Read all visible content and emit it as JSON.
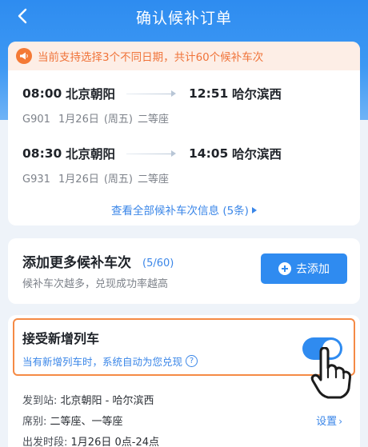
{
  "nav": {
    "title": "确认候补订单"
  },
  "notice": {
    "text": "当前支持选择3个不同日期，共计60个候补车次"
  },
  "trains": [
    {
      "depart_time": "08:00",
      "depart_station": "北京朝阳",
      "arrive_time": "12:51",
      "arrive_station": "哈尔滨西",
      "train_no": "G901",
      "date": "1月26日",
      "weekday": "(周五)",
      "seat": "二等座"
    },
    {
      "depart_time": "08:30",
      "depart_station": "北京朝阳",
      "arrive_time": "14:05",
      "arrive_station": "哈尔滨西",
      "train_no": "G931",
      "date": "1月26日",
      "weekday": "(周五)",
      "seat": "二等座"
    }
  ],
  "view_all": {
    "label": "查看全部候补车次信息 (5条)"
  },
  "add_more": {
    "title": "添加更多候补车次",
    "count": "(5/60)",
    "subtitle": "候补车次越多，兑现成功率越高",
    "button_label": "去添加"
  },
  "accept_new": {
    "title": "接受新增列车",
    "subtitle": "当有新增列车时，系统自动为您兑现",
    "help": "?",
    "toggle_on": true
  },
  "details": {
    "route_label": "发到站:",
    "route_value": "北京朝阳 - 哈尔滨西",
    "seat_label": "席别:",
    "seat_value": "二等座、一等座",
    "time_label": "出发时段:",
    "time_value": "1月26日 0点-24点",
    "settings_label": "设置"
  },
  "colors": {
    "primary": "#2f8bf0",
    "notice_text": "#f0743a",
    "notice_bg": "#fdeee6",
    "highlight_border": "#f58a45"
  }
}
